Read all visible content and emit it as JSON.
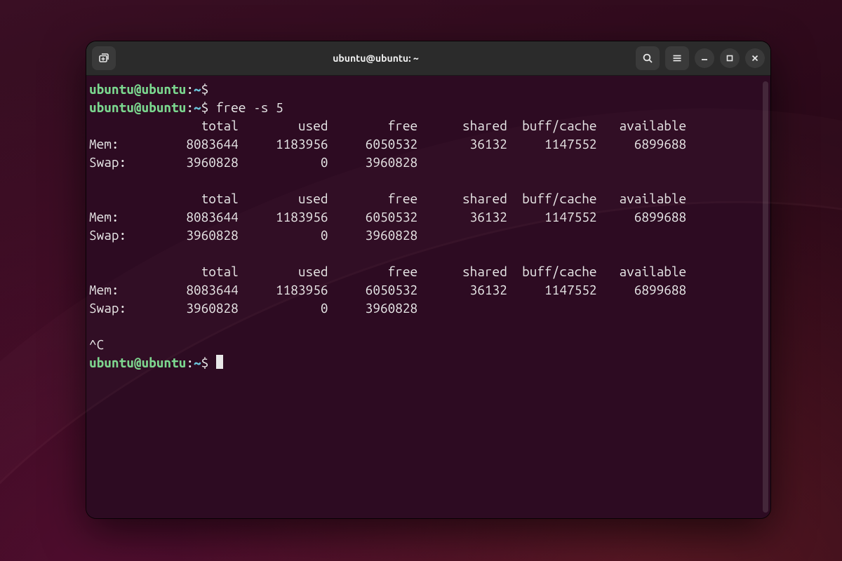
{
  "window": {
    "title": "ubuntu@ubuntu: ~"
  },
  "prompt": {
    "user_host": "ubuntu@ubuntu",
    "colon": ":",
    "cwd": "~",
    "dollar": "$"
  },
  "commands": {
    "empty": "",
    "free": "free -s 5",
    "interrupt": "^C"
  },
  "free_output": {
    "header": "               total        used        free      shared  buff/cache   available",
    "mem": "Mem:         8083644     1183956     6050532       36132     1147552     6899688",
    "swap": "Swap:        3960828           0     3960828"
  },
  "icons": {
    "new_tab": "new-tab",
    "search": "search",
    "menu": "menu",
    "minimize": "minimize",
    "maximize": "maximize",
    "close": "close"
  }
}
